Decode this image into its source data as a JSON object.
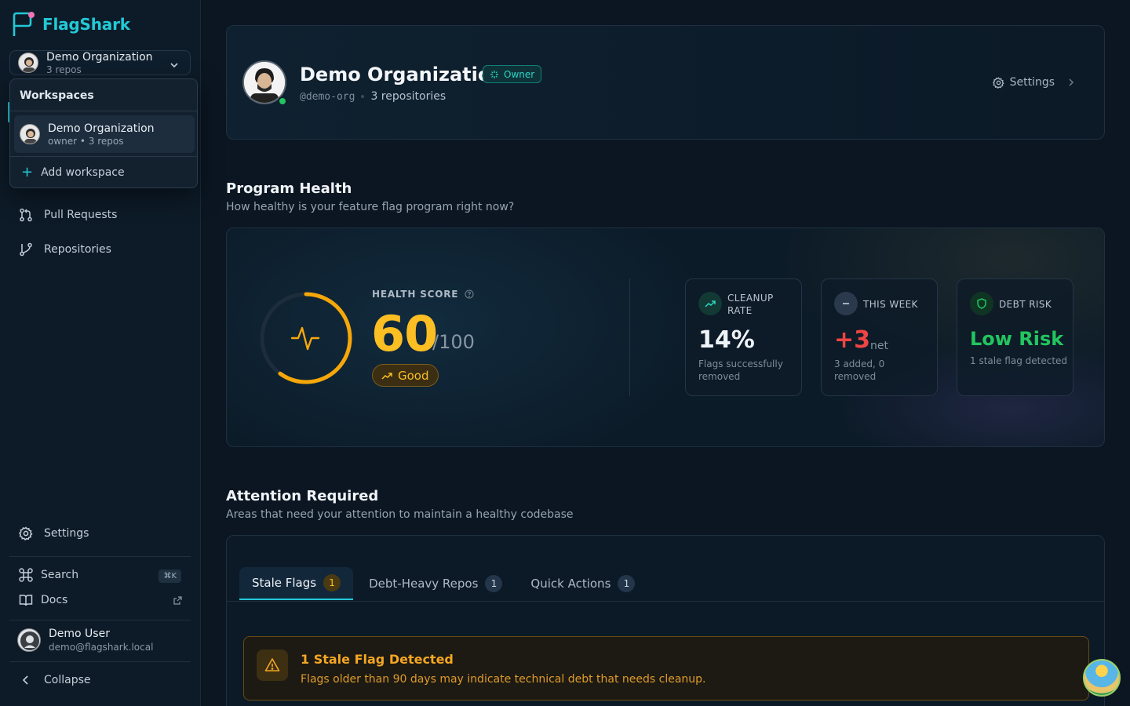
{
  "brand": {
    "name": "FlagShark"
  },
  "org_switcher": {
    "name": "Demo Organization",
    "meta": "3 repos"
  },
  "workspaces_menu": {
    "header": "Workspaces",
    "items": [
      {
        "name": "Demo Organization",
        "meta": "owner • 3 repos"
      }
    ],
    "add_label": "Add workspace"
  },
  "nav": {
    "pull_requests": "Pull Requests",
    "repositories": "Repositories",
    "settings": "Settings",
    "search": "Search",
    "search_shortcut": "⌘K",
    "docs": "Docs",
    "collapse": "Collapse"
  },
  "user": {
    "name": "Demo User",
    "email": "demo@flagshark.local"
  },
  "org_header": {
    "title": "Demo Organization",
    "role_badge": "Owner",
    "handle": "@demo-org",
    "repos": "3 repositories",
    "settings_label": "Settings"
  },
  "program_health": {
    "title": "Program Health",
    "subtitle": "How healthy is your feature flag program right now?",
    "score_label": "HEALTH SCORE",
    "score": "60",
    "score_max": "/100",
    "score_fraction": 0.6,
    "status": "Good",
    "stats": [
      {
        "label": "CLEANUP RATE",
        "value": "14%",
        "desc": "Flags successfully removed",
        "color": "#eef3f8"
      },
      {
        "label": "THIS WEEK",
        "value": "+3",
        "unit": "net",
        "desc": "3 added, 0 removed",
        "color": "#ef4444"
      },
      {
        "label": "DEBT RISK",
        "value": "Low Risk",
        "desc": "1 stale flag detected",
        "color": "#22c55e"
      }
    ]
  },
  "attention": {
    "title": "Attention Required",
    "subtitle": "Areas that need your attention to maintain a healthy codebase",
    "tabs": [
      {
        "label": "Stale Flags",
        "count": "1"
      },
      {
        "label": "Debt-Heavy Repos",
        "count": "1"
      },
      {
        "label": "Quick Actions",
        "count": "1"
      }
    ],
    "alert": {
      "title": "1 Stale Flag Detected",
      "text": "Flags older than 90 days may indicate technical debt that needs cleanup."
    }
  },
  "colors": {
    "accent": "#22c9d6",
    "warning": "#fbbf24",
    "success": "#22c55e",
    "danger": "#ef4444"
  }
}
